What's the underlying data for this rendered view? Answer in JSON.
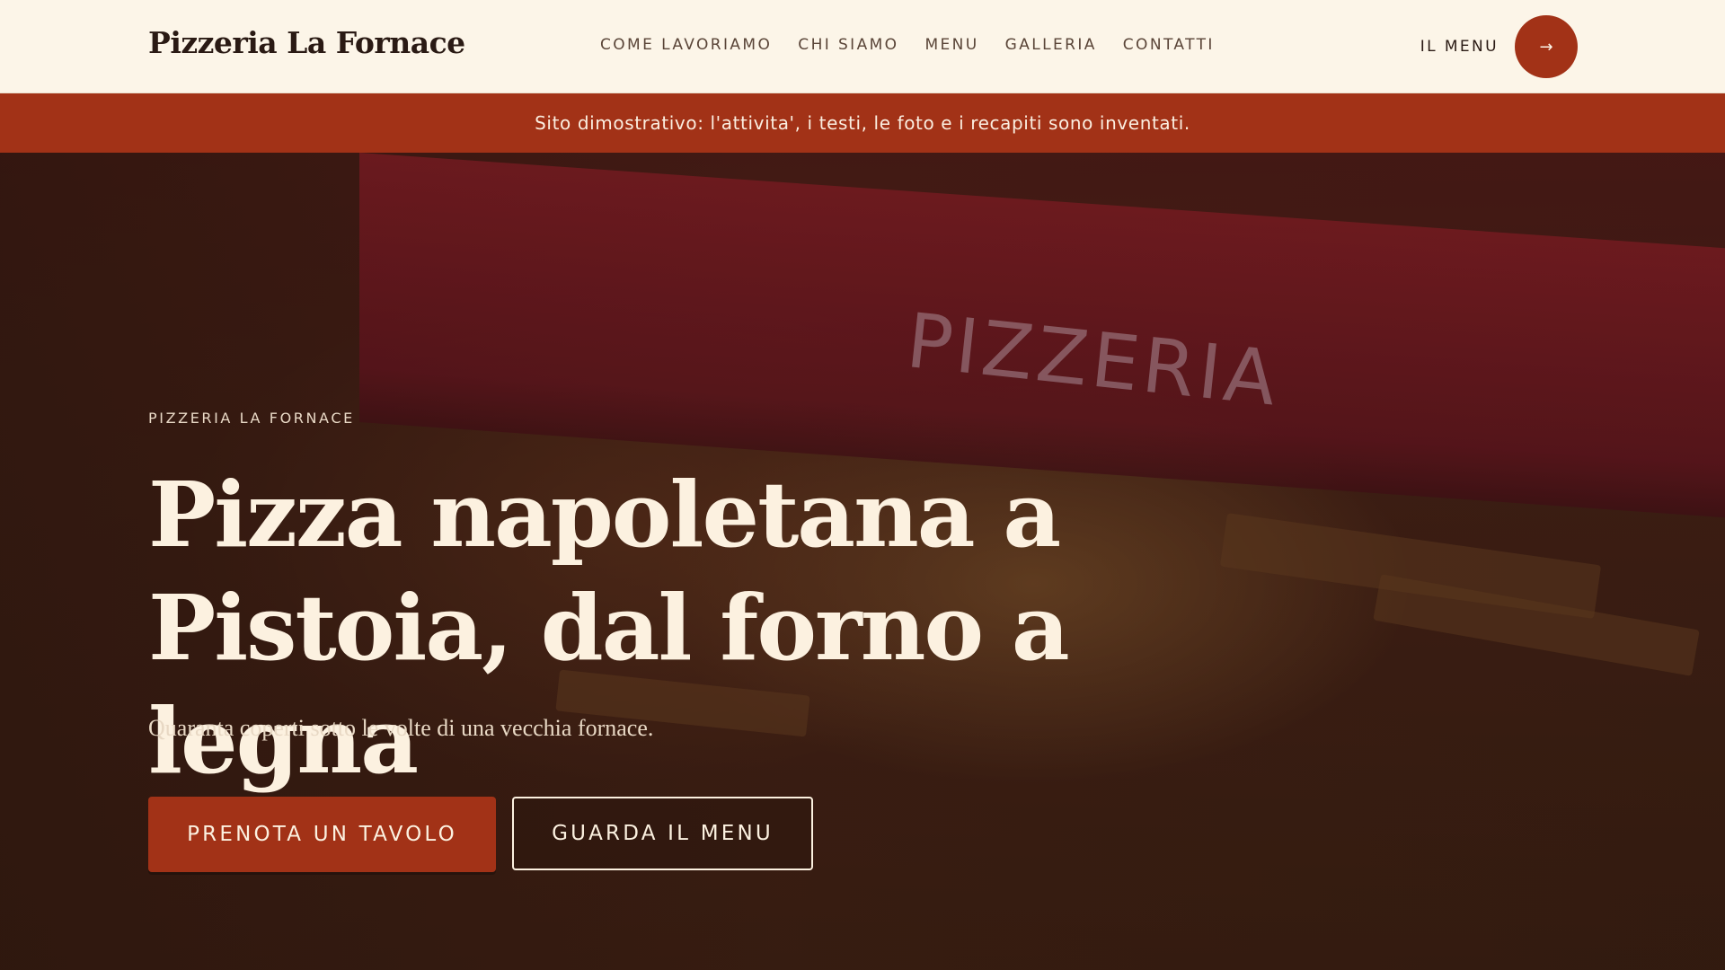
{
  "header": {
    "brand": "Pizzeria La Fornace",
    "nav": [
      {
        "label": "COME LAVORIAMO"
      },
      {
        "label": "CHI SIAMO"
      },
      {
        "label": "MENU"
      },
      {
        "label": "GALLERIA"
      },
      {
        "label": "CONTATTI"
      }
    ],
    "menu_cta": {
      "label": "IL MENU",
      "icon": "arrow-right-icon",
      "glyph": "→"
    }
  },
  "notice": {
    "text": "Sito dimostrativo: l'attivita', i testi, le foto e i recapiti sono inventati."
  },
  "hero": {
    "background_sign_text": "PIZZERIA",
    "eyebrow": "PIZZERIA LA FORNACE",
    "headline": "Pizza napoletana a Pistoia, dal forno a legna",
    "subhead": "Quaranta coperti sotto le volte di una vecchia fornace.",
    "primary_button": "PRENOTA UN TAVOLO",
    "secondary_button": "GUARDA IL MENU"
  },
  "colors": {
    "accent": "#a23217",
    "header_bg": "#fcf5e8",
    "text_dark": "#2a1a14",
    "hero_text": "#fcf1e0"
  }
}
